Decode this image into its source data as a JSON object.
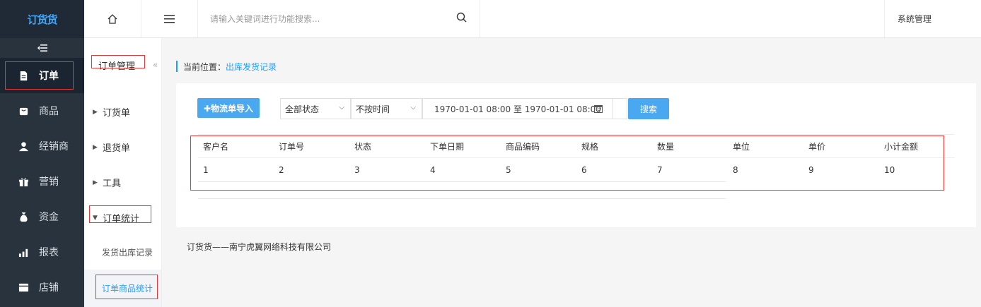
{
  "logo": "订货货",
  "sidebar": {
    "items": [
      {
        "label": "订单",
        "icon": "document-icon"
      },
      {
        "label": "商品",
        "icon": "box-icon"
      },
      {
        "label": "经销商",
        "icon": "user-icon"
      },
      {
        "label": "营销",
        "icon": "gift-icon"
      },
      {
        "label": "资金",
        "icon": "money-bag-icon"
      },
      {
        "label": "报表",
        "icon": "bar-chart-icon"
      },
      {
        "label": "店铺",
        "icon": "store-icon"
      }
    ]
  },
  "subnav": {
    "title": "订单管理",
    "items": [
      "订货单",
      "退货单",
      "工具",
      "订单统计"
    ],
    "children": [
      "发货出库记录",
      "订单商品统计"
    ]
  },
  "topbar": {
    "search_placeholder": "请输入关键词进行功能搜索...",
    "system": "系统管理"
  },
  "breadcrumb": {
    "prefix": "当前位置：",
    "current": "出库发货记录"
  },
  "toolbar": {
    "import_label": "✚物流单导入",
    "status_select": "全部状态",
    "time_select": "不按时间",
    "date_range": "1970-01-01 08:00 至 1970-01-01 08:00",
    "search_label": "搜索"
  },
  "table": {
    "columns": [
      "客户名",
      "订单号",
      "状态",
      "下单日期",
      "商品编码",
      "规格",
      "数量",
      "单位",
      "单价",
      "小计金额"
    ],
    "rows": [
      [
        "1",
        "2",
        "3",
        "4",
        "5",
        "6",
        "7",
        "8",
        "9",
        "10"
      ]
    ]
  },
  "footer": "订货货——南宁虎翼网络科技有限公司",
  "colors": {
    "sidebar_bg": "#28333e",
    "accent": "#4aa8f0",
    "link": "#1e9fff",
    "highlight_box": "#e53935"
  }
}
